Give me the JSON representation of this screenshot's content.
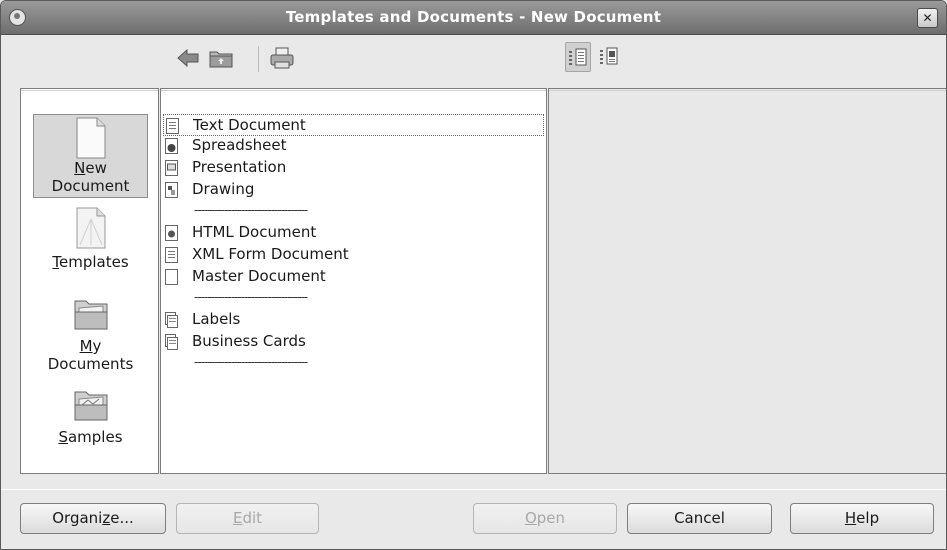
{
  "window": {
    "title": "Templates and Documents - New Document",
    "close_glyph": "✕"
  },
  "toolbar": {
    "icons": [
      "back-arrow-icon",
      "up-folder-icon",
      "print-icon"
    ],
    "view_icons": [
      "document-view-icon",
      "preview-view-icon"
    ]
  },
  "categories": [
    {
      "label_pre": "",
      "label_ul": "N",
      "label_post": "ew",
      "label_line2": "Document",
      "icon": "new-document-icon",
      "selected": true
    },
    {
      "label_pre": "",
      "label_ul": "T",
      "label_post": "emplates",
      "label_line2": "",
      "icon": "templates-icon",
      "selected": false
    },
    {
      "label_pre": "",
      "label_ul": "M",
      "label_post": "y",
      "label_line2": "Documents",
      "icon": "folder-icon",
      "selected": false
    },
    {
      "label_pre": "",
      "label_ul": "S",
      "label_post": "amples",
      "label_line2": "",
      "icon": "samples-folder-icon",
      "selected": false
    }
  ],
  "documents": [
    {
      "label": "Text Document",
      "icon": "text-document-icon",
      "focused": true
    },
    {
      "label": "Spreadsheet",
      "icon": "spreadsheet-icon"
    },
    {
      "label": "Presentation",
      "icon": "presentation-icon"
    },
    {
      "label": "Drawing",
      "icon": "drawing-icon"
    },
    {
      "label": "HTML Document",
      "icon": "html-document-icon"
    },
    {
      "label": "XML Form Document",
      "icon": "xml-form-icon"
    },
    {
      "label": "Master Document",
      "icon": "master-document-icon"
    },
    {
      "label": "Labels",
      "icon": "labels-icon"
    },
    {
      "label": "Business Cards",
      "icon": "business-cards-icon"
    }
  ],
  "separator_text": "----------------------------------",
  "buttons": {
    "organize": {
      "pre": "Organi",
      "ul": "z",
      "post": "e..."
    },
    "edit": {
      "pre": "",
      "ul": "E",
      "post": "dit"
    },
    "open": {
      "pre": "",
      "ul": "O",
      "post": "pen"
    },
    "cancel": {
      "pre": "Cancel",
      "ul": "",
      "post": ""
    },
    "help": {
      "pre": "",
      "ul": "H",
      "post": "elp"
    }
  }
}
